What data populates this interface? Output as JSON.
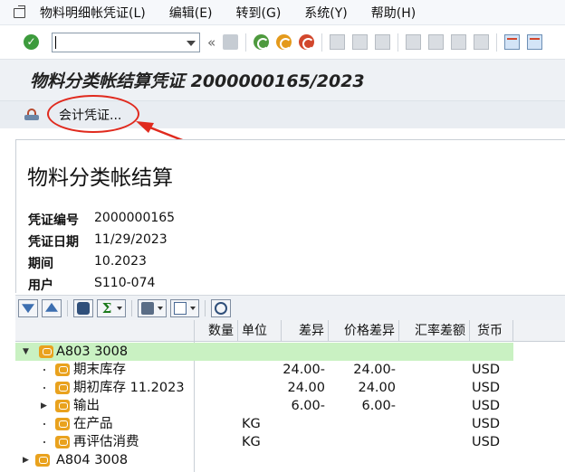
{
  "menu": {
    "items": [
      {
        "label": "物料明细帐凭证(L)"
      },
      {
        "label": "编辑(E)"
      },
      {
        "label": "转到(G)"
      },
      {
        "label": "系统(Y)"
      },
      {
        "label": "帮助(H)"
      }
    ]
  },
  "toolbar": {
    "command_field_value": "",
    "collapse_symbol": "«",
    "icons": [
      "ok-icon",
      "save-icon",
      "back-icon",
      "exit-icon",
      "cancel-icon",
      "print-icon",
      "find-icon",
      "find-next-icon",
      "first-page-icon",
      "prev-page-icon",
      "next-page-icon",
      "last-page-icon",
      "new-session-icon",
      "shortcut-icon"
    ]
  },
  "title": "物料分类帐结算凭证 2000000165/2023",
  "app_toolbar": {
    "accounting_doc_label": "会计凭证..."
  },
  "header": {
    "heading": "物料分类帐结算",
    "fields": [
      {
        "label": "凭证编号",
        "value": "2000000165"
      },
      {
        "label": "凭证日期",
        "value": "11/29/2023"
      },
      {
        "label": "期间",
        "value": "10.2023"
      },
      {
        "label": "用户",
        "value": "S110-074"
      }
    ]
  },
  "grid": {
    "columns": [
      "数量",
      "单位",
      "差异",
      "价格差异",
      "汇率差额",
      "货币"
    ],
    "rows": [
      {
        "level": 0,
        "expanded": true,
        "label": "A803 3008",
        "highlight": true,
        "qty": "",
        "unit": "",
        "diff": "",
        "price_diff": "",
        "fx_diff": "",
        "currency": ""
      },
      {
        "level": 1,
        "label": "期末库存",
        "qty": "",
        "unit": "",
        "diff": "24.00-",
        "price_diff": "24.00-",
        "fx_diff": "",
        "currency": "USD"
      },
      {
        "level": 1,
        "label": "期初库存 11.2023",
        "qty": "",
        "unit": "",
        "diff": "24.00",
        "price_diff": "24.00",
        "fx_diff": "",
        "currency": "USD"
      },
      {
        "level": 1,
        "label": "输出",
        "qty": "",
        "unit": "",
        "diff": "6.00-",
        "price_diff": "6.00-",
        "fx_diff": "",
        "currency": "USD"
      },
      {
        "level": 1,
        "label": "在产品",
        "qty": "",
        "unit": "KG",
        "diff": "",
        "price_diff": "",
        "fx_diff": "",
        "currency": "USD"
      },
      {
        "level": 1,
        "label": "再评估消费",
        "qty": "",
        "unit": "KG",
        "diff": "",
        "price_diff": "",
        "fx_diff": "",
        "currency": "USD"
      },
      {
        "level": 0,
        "expanded": false,
        "label": "A804 3008",
        "highlight": false,
        "qty": "",
        "unit": "",
        "diff": "",
        "price_diff": "",
        "fx_diff": "",
        "currency": ""
      }
    ]
  },
  "colors": {
    "highlight_row": "#c9f1c2",
    "annotation": "#e02a1e",
    "node_icon": "#e9a21e"
  }
}
